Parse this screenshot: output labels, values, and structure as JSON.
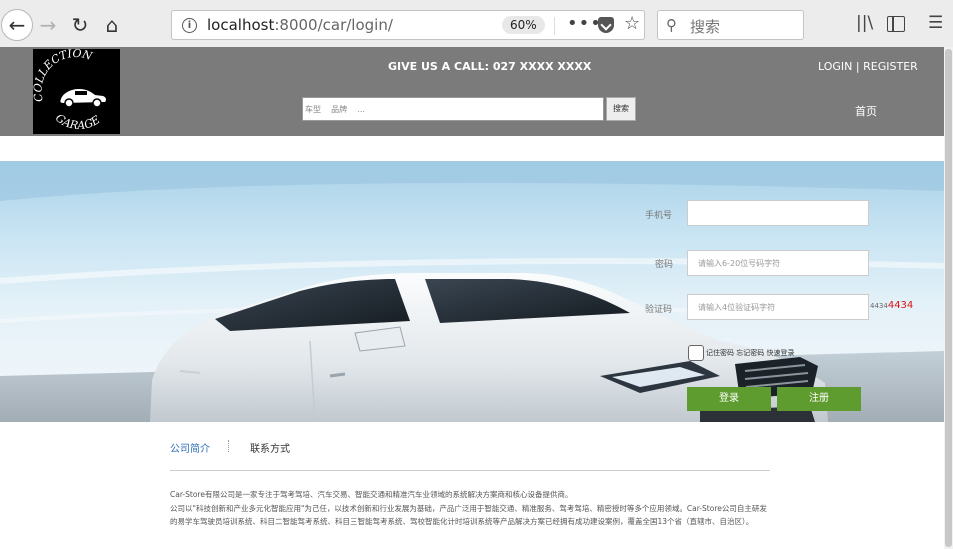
{
  "browser": {
    "url_host": "localhost",
    "url_path": ":8000/car/login/",
    "zoom": "60%",
    "search_placeholder": "搜索"
  },
  "header": {
    "logo_text_top": "COLLECTION",
    "logo_text_bottom": "GARAGE",
    "call_text": "GIVE US A CALL: 027 XXXX XXXX",
    "login_label": "LOGIN",
    "auth_separator": "|",
    "register_label": "REGISTER",
    "search_placeholder": "车型    品牌    ...",
    "search_button": "搜索",
    "nav_home": "首页"
  },
  "login_form": {
    "phone_label": "手机号",
    "phone_value": "",
    "password_label": "密码",
    "password_placeholder": "请输入6-20位号码字符",
    "captcha_label": "验证码",
    "captcha_placeholder": "请输入4位验证码字符",
    "captcha_small": "4434",
    "captcha_code": "4434",
    "remember_text": "记住密码 忘记密码 快速登录",
    "login_button": "登录",
    "register_button": "注册"
  },
  "footer": {
    "tab_intro": "公司简介",
    "tab_contact": "联系方式",
    "para1": "Car-Store有限公司是一家专注于驾考驾培、汽车交易、智能交通和精准汽车业领域的系统解决方案商和核心设备提供商。",
    "para2": "公司以\"科技创新和产业多元化智能应用\"为己任，以技术创新和行业发展为基础，产品广泛用于智能交通、精准服务、驾考驾培、精密授时等多个应用领域。Car-Store公司自主研发的易学车驾驶员培训系统、科目二智能驾考系统、科目三智能驾考系统、驾校智能化计时培训系统等产品解决方案已经拥有成功建设案例，覆盖全国13个省（直辖市、自治区）。"
  },
  "colors": {
    "header_bg": "#7b7b7b",
    "button_green": "#5f9c2f",
    "link_blue": "#2c6fb7",
    "captcha_red": "#dd1111"
  }
}
